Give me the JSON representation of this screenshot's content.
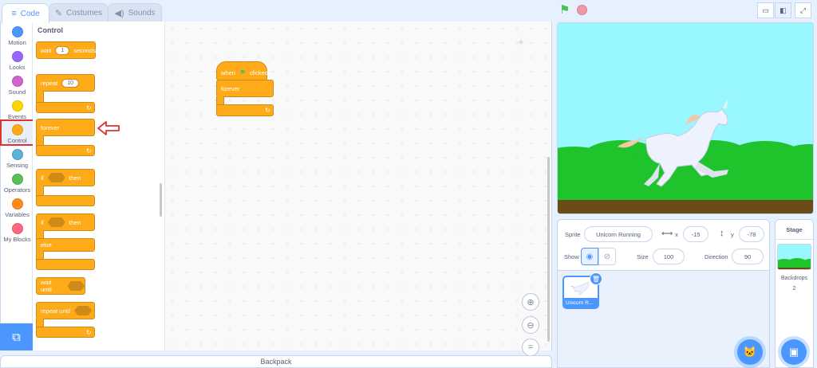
{
  "tabs": [
    {
      "label": "Code",
      "icon": "code-icon",
      "active": true
    },
    {
      "label": "Costumes",
      "icon": "brush-icon"
    },
    {
      "label": "Sounds",
      "icon": "speaker-icon"
    }
  ],
  "categories": [
    {
      "label": "Motion",
      "color": "#4c97ff"
    },
    {
      "label": "Looks",
      "color": "#9966ff"
    },
    {
      "label": "Sound",
      "color": "#cf63cf"
    },
    {
      "label": "Events",
      "color": "#ffd500"
    },
    {
      "label": "Control",
      "color": "#ffab19",
      "selected": true
    },
    {
      "label": "Sensing",
      "color": "#5cb1d6"
    },
    {
      "label": "Operators",
      "color": "#59c059"
    },
    {
      "label": "Variables",
      "color": "#ff8c1a"
    },
    {
      "label": "My Blocks",
      "color": "#ff6680"
    }
  ],
  "palette": {
    "title": "Control",
    "wait": {
      "label": "wait",
      "value": "1",
      "suffix": "seconds"
    },
    "repeat": {
      "label": "repeat",
      "value": "10"
    },
    "forever": {
      "label": "forever"
    },
    "if_then": {
      "label": "if",
      "then": "then"
    },
    "if_else": {
      "label": "if",
      "then": "then",
      "else": "else"
    },
    "wait_until": {
      "label": "wait until"
    },
    "repeat_until": {
      "label": "repeat until"
    }
  },
  "script": {
    "hat_prefix": "when",
    "hat_suffix": "clicked",
    "forever": "forever"
  },
  "backpack": {
    "label": "Backpack"
  },
  "sprite_info": {
    "sprite_label": "Sprite",
    "sprite_name": "Unicorn Running",
    "x_label": "x",
    "x_value": "-15",
    "y_label": "y",
    "y_value": "-78",
    "show_label": "Show",
    "size_label": "Size",
    "size_value": "100",
    "direction_label": "Direction",
    "direction_value": "90"
  },
  "sprites": [
    {
      "name": "Unicorn R..."
    }
  ],
  "stage_pane": {
    "title": "Stage",
    "backdrops_label": "Backdrops",
    "backdrops_count": "2"
  },
  "colors": {
    "accent": "#4c97ff",
    "control": "#ffab19",
    "highlight": "#e0322f"
  }
}
